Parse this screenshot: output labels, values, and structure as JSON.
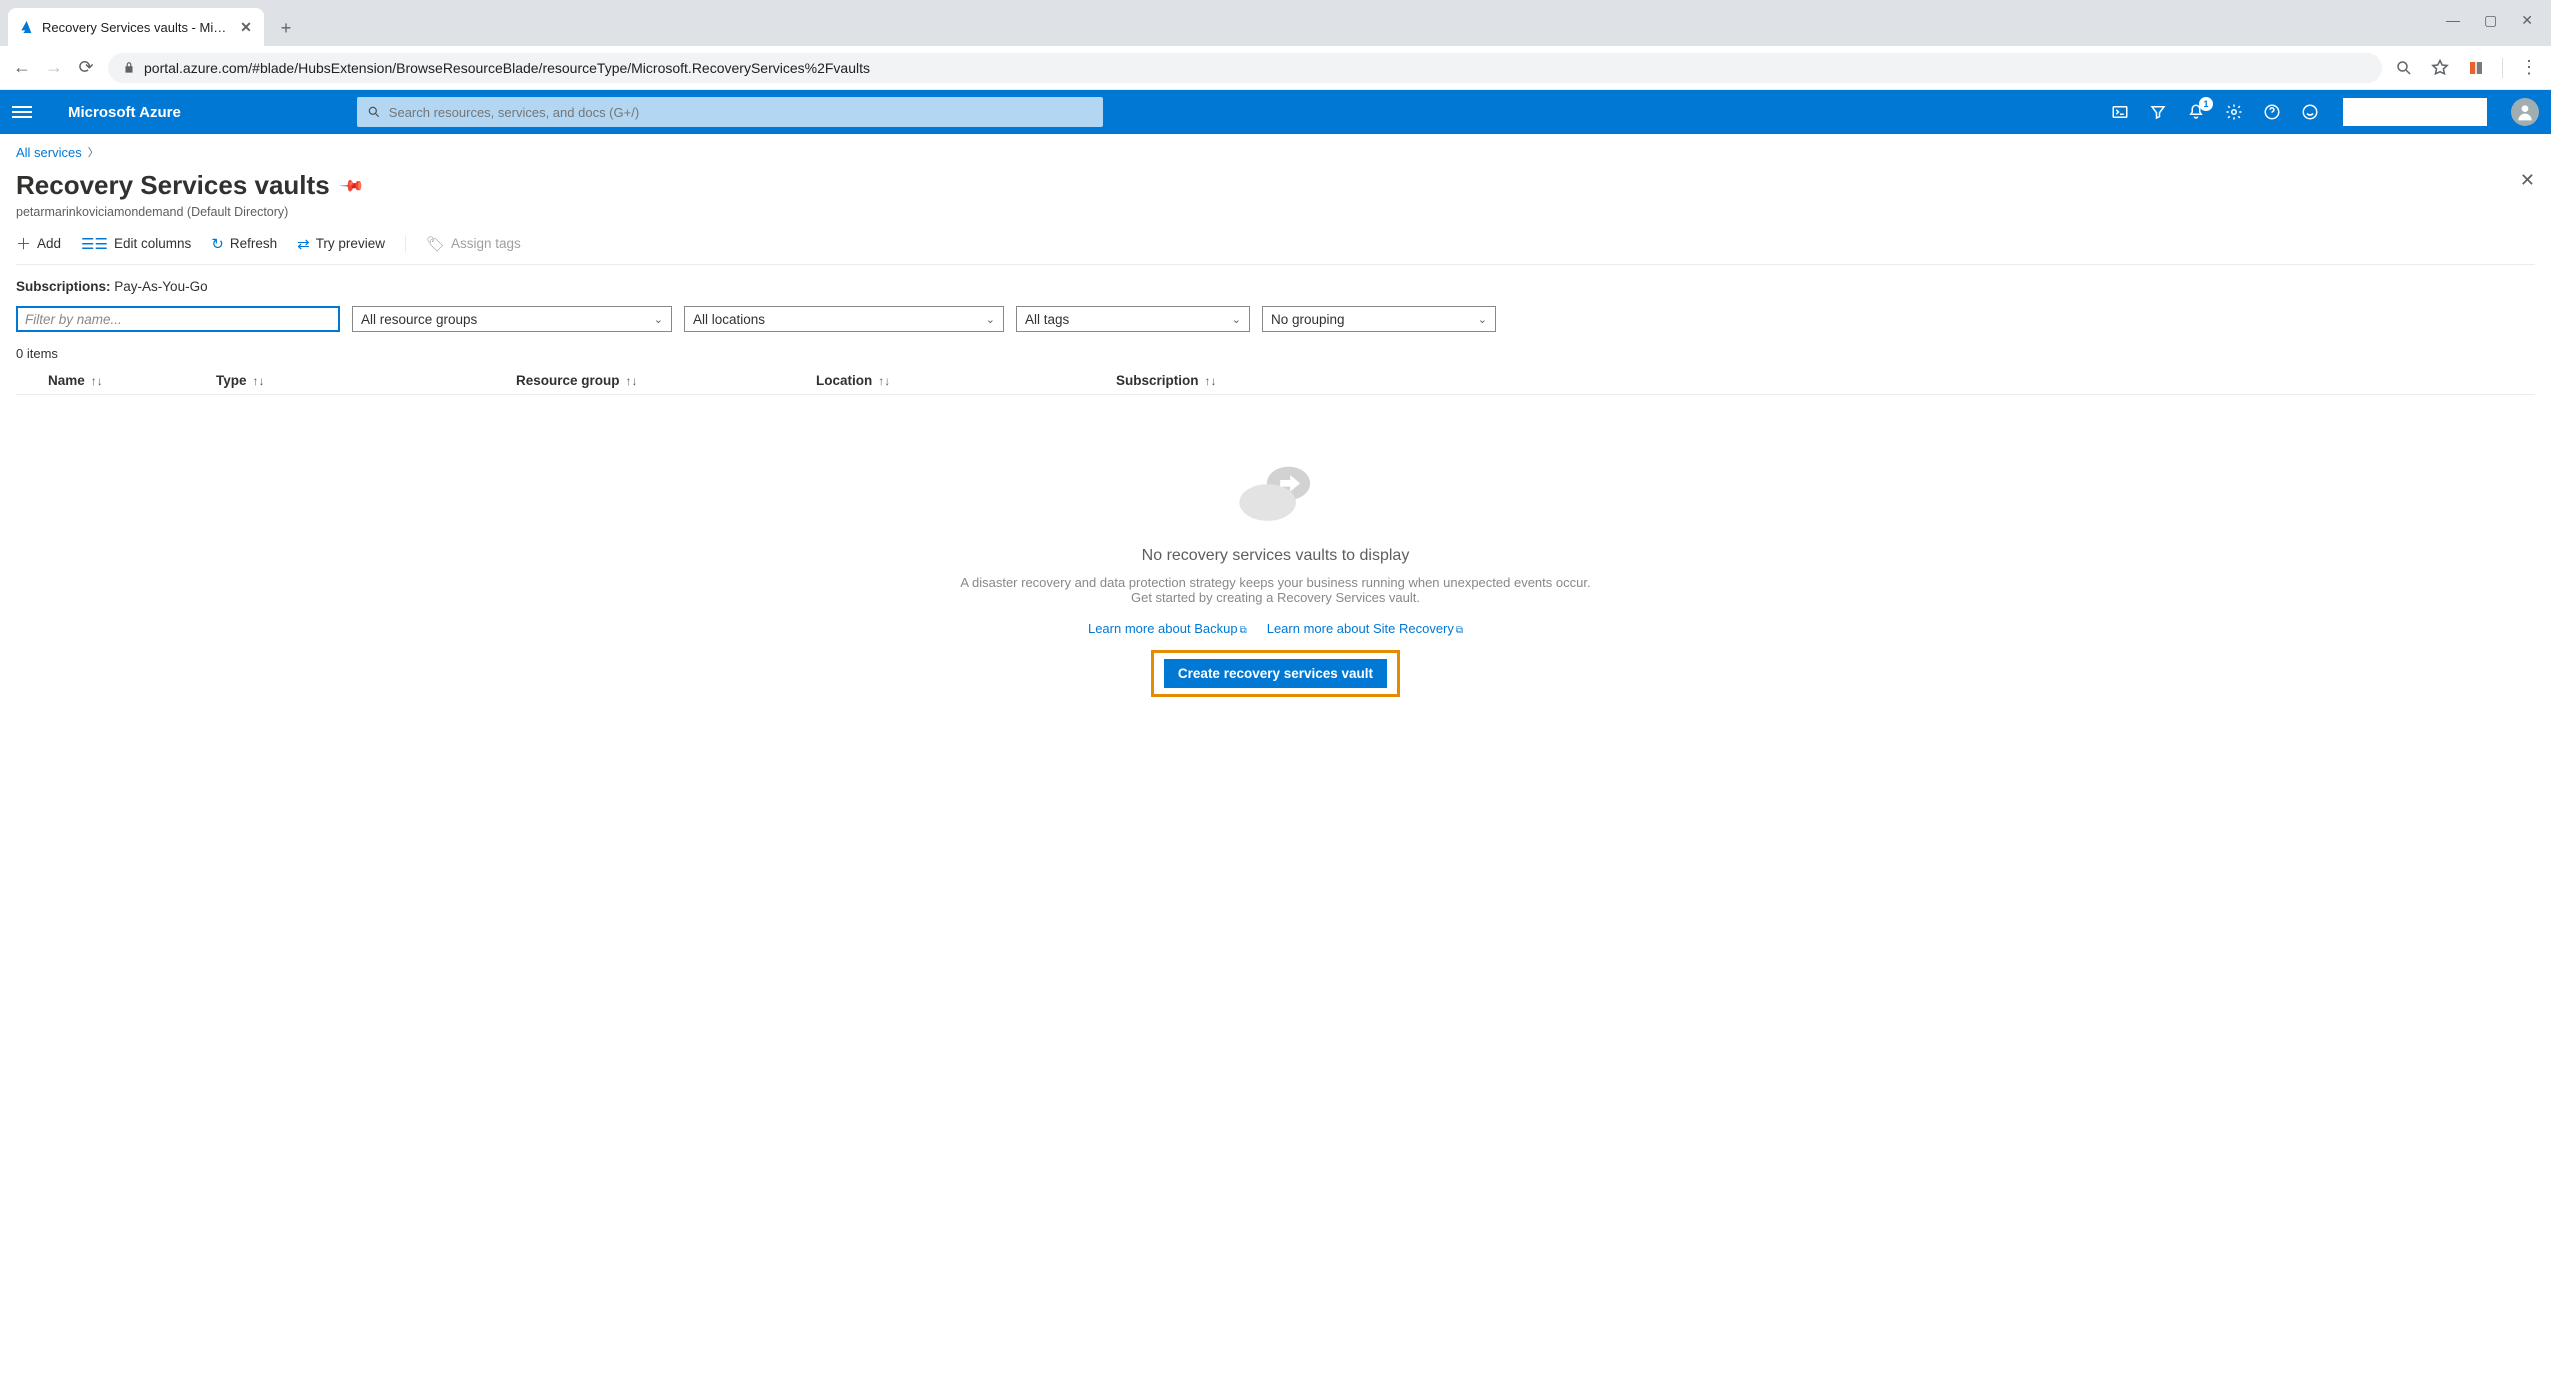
{
  "browser": {
    "tab_title": "Recovery Services vaults - Micros",
    "url": "portal.azure.com/#blade/HubsExtension/BrowseResourceBlade/resourceType/Microsoft.RecoveryServices%2Fvaults"
  },
  "header": {
    "brand": "Microsoft Azure",
    "search_placeholder": "Search resources, services, and docs (G+/)",
    "notification_count": "1"
  },
  "breadcrumb": {
    "root": "All services"
  },
  "page": {
    "title": "Recovery Services vaults",
    "subtitle": "petarmarinkoviciamondemand (Default Directory)"
  },
  "toolbar": {
    "add": "Add",
    "edit_columns": "Edit columns",
    "refresh": "Refresh",
    "try_preview": "Try preview",
    "assign_tags": "Assign tags"
  },
  "subscriptions": {
    "label": "Subscriptions:",
    "value": "Pay-As-You-Go"
  },
  "filters": {
    "name_placeholder": "Filter by name...",
    "resource_groups": "All resource groups",
    "locations": "All locations",
    "tags": "All tags",
    "grouping": "No grouping"
  },
  "table": {
    "count": "0 items",
    "columns": {
      "name": "Name",
      "type": "Type",
      "resource_group": "Resource group",
      "location": "Location",
      "subscription": "Subscription"
    }
  },
  "empty": {
    "title": "No recovery services vaults to display",
    "desc": "A disaster recovery and data protection strategy keeps your business running when unexpected events occur. Get started by creating a Recovery Services vault.",
    "link_backup": "Learn more about Backup",
    "link_sr": "Learn more about Site Recovery",
    "button": "Create recovery services vault"
  }
}
